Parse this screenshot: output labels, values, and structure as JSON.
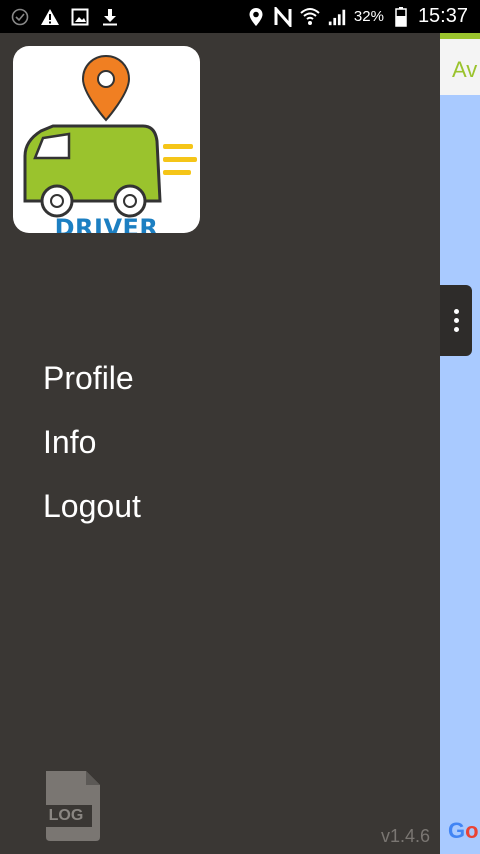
{
  "status_bar": {
    "battery_percent": "32%",
    "time": "15:37",
    "icons_left": [
      "check-circle-icon",
      "warning-icon",
      "image-icon",
      "download-icon"
    ],
    "icons_right": [
      "location-pin-icon",
      "nfc-icon",
      "wifi-icon",
      "signal-icon",
      "battery-icon"
    ]
  },
  "drawer": {
    "logo": {
      "text": "DRIVER",
      "colors": {
        "pin": "#f07f22",
        "van": "#9ac32d",
        "text": "#1c7fc2",
        "lines": "#f5c518"
      }
    },
    "menu": [
      {
        "label": "Profile"
      },
      {
        "label": "Info"
      },
      {
        "label": "Logout"
      }
    ],
    "log_icon_label": "LOG",
    "version": "v1.4.6"
  },
  "background": {
    "tab_text_partial": "Av",
    "google_partial": "Go",
    "accent": "#9ac32d",
    "map_color": "#a9caff"
  }
}
